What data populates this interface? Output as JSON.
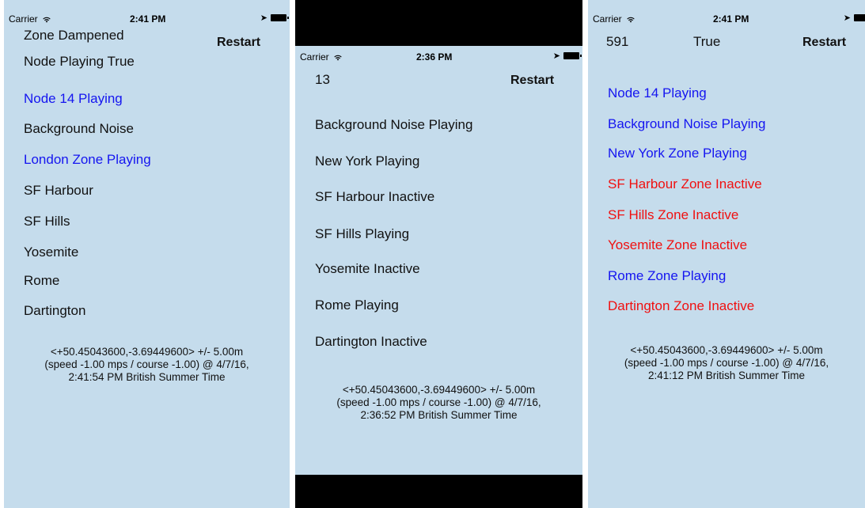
{
  "colors": {
    "background": "#c5dcec",
    "playing": "#1515f0",
    "inactive": "#f01010",
    "default": "#111111"
  },
  "screen1": {
    "status": {
      "carrier": "Carrier",
      "time": "2:41 PM"
    },
    "header_line1": "Zone Dampened",
    "header_line2": "Node Playing True",
    "restart": "Restart",
    "items": [
      {
        "label": "Node 14 Playing",
        "state": "playing"
      },
      {
        "label": "Background Noise",
        "state": "default"
      },
      {
        "label": "London Zone Playing",
        "state": "playing"
      },
      {
        "label": "SF Harbour",
        "state": "default"
      },
      {
        "label": "SF Hills",
        "state": "default"
      },
      {
        "label": "Yosemite",
        "state": "default"
      },
      {
        "label": "Rome",
        "state": "default"
      },
      {
        "label": "Dartington",
        "state": "default"
      }
    ],
    "location": {
      "line1": "<+50.45043600,-3.69449600> +/- 5.00m",
      "line2": "(speed -1.00 mps / course -1.00) @ 4/7/16,",
      "line3": "2:41:54 PM British Summer Time"
    }
  },
  "screen2": {
    "status": {
      "carrier": "Carrier",
      "time": "2:36 PM"
    },
    "header_count": "13",
    "restart": "Restart",
    "items": [
      {
        "label": "Background Noise Playing",
        "state": "default"
      },
      {
        "label": "New York Playing",
        "state": "default"
      },
      {
        "label": "SF Harbour Inactive",
        "state": "default"
      },
      {
        "label": "SF Hills Playing",
        "state": "default"
      },
      {
        "label": "Yosemite Inactive",
        "state": "default"
      },
      {
        "label": "Rome Playing",
        "state": "default"
      },
      {
        "label": "Dartington Inactive",
        "state": "default"
      }
    ],
    "location": {
      "line1": "<+50.45043600,-3.69449600> +/- 5.00m",
      "line2": "(speed -1.00 mps / course -1.00) @ 4/7/16,",
      "line3": "2:36:52 PM British Summer Time"
    }
  },
  "screen3": {
    "status": {
      "carrier": "Carrier",
      "time": "2:41 PM"
    },
    "header_count": "591",
    "header_flag": "True",
    "restart": "Restart",
    "items": [
      {
        "label": "Node 14 Playing",
        "state": "playing"
      },
      {
        "label": "Background Noise Playing",
        "state": "playing"
      },
      {
        "label": "New York Zone Playing",
        "state": "playing"
      },
      {
        "label": "SF Harbour Zone Inactive",
        "state": "inactive"
      },
      {
        "label": "SF Hills Zone Inactive",
        "state": "inactive"
      },
      {
        "label": "Yosemite Zone Inactive",
        "state": "inactive"
      },
      {
        "label": "Rome Zone Playing",
        "state": "playing"
      },
      {
        "label": "Dartington Zone Inactive",
        "state": "inactive"
      }
    ],
    "location": {
      "line1": "<+50.45043600,-3.69449600> +/- 5.00m",
      "line2": "(speed -1.00 mps / course -1.00) @ 4/7/16,",
      "line3": "2:41:12 PM British Summer Time"
    }
  }
}
